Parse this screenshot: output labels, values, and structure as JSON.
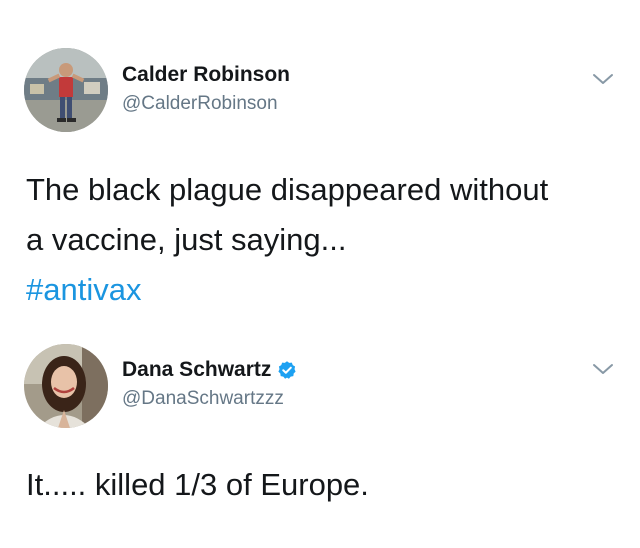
{
  "tweets": [
    {
      "display_name": "Calder Robinson",
      "handle": "@CalderRobinson",
      "verified": false,
      "text_line1": "The black plague disappeared without",
      "text_line2": "a vaccine, just saying...",
      "hashtag": "#antivax"
    },
    {
      "display_name": "Dana Schwartz",
      "handle": "@DanaSchwartzzz",
      "verified": true,
      "text": "It..... killed 1/3 of Europe."
    }
  ],
  "colors": {
    "text": "#14171a",
    "secondary": "#657786",
    "link": "#1b95e0",
    "verified": "#1da1f2"
  },
  "icons": [
    "chevron-down-icon",
    "verified-badge-icon"
  ]
}
